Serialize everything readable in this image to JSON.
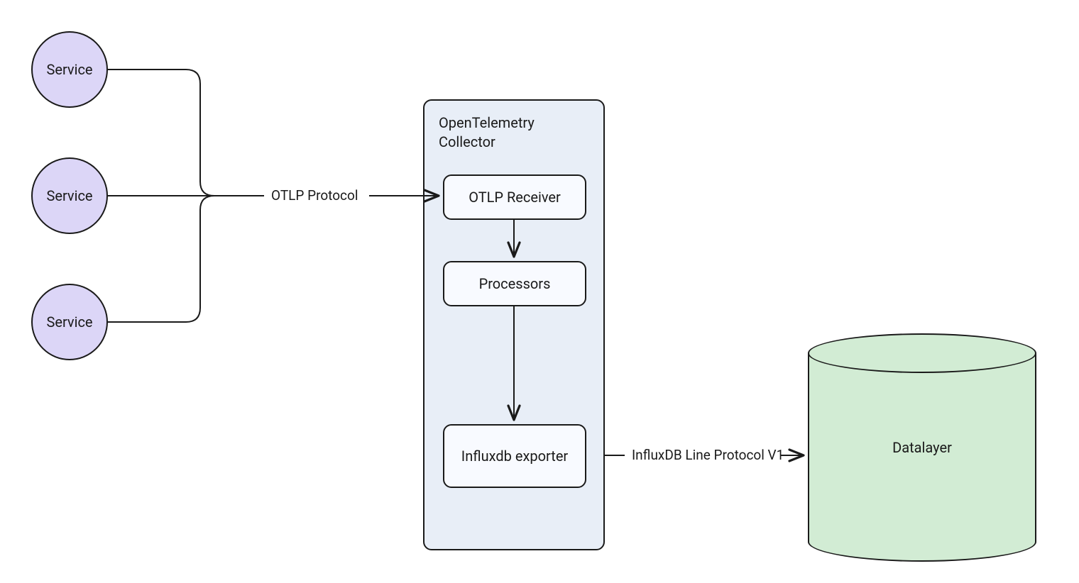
{
  "services": {
    "s1": "Service",
    "s2": "Service",
    "s3": "Service"
  },
  "collector": {
    "title": "OpenTelemetry Collector",
    "receiver": "OTLP Receiver",
    "processors": "Processors",
    "exporter": "Influxdb exporter"
  },
  "datalayer": {
    "label": "Datalayer"
  },
  "edges": {
    "otlp": "OTLP Protocol",
    "influx": "InfluxDB Line Protocol V1"
  }
}
